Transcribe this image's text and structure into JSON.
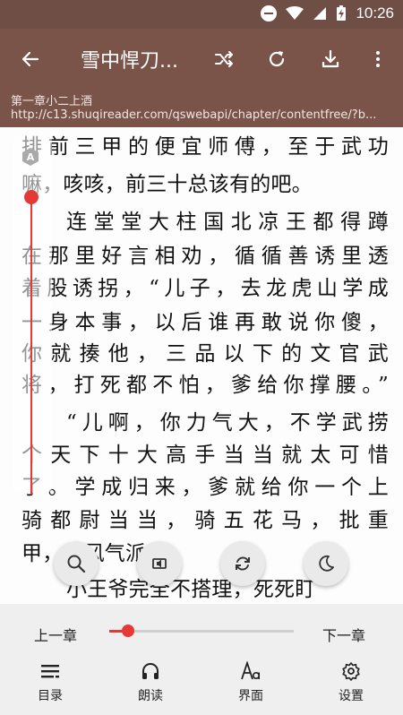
{
  "status": {
    "time": "10:26"
  },
  "toolbar": {
    "title": "雪中悍刀..."
  },
  "chapter": {
    "name": "第一章小二上酒",
    "url": "http://c13.shuqireader.com/qswebapi/chapter/contentfree/?b..."
  },
  "reader": {
    "lines": [
      "排前三甲的便宜师傅，至于武功",
      "嘛，咳咳，前三十总该有的吧。",
      "连堂堂大柱国北凉王都得蹲",
      "在那里好言相劝，循循善诱里透",
      "着股诱拐，“儿子，去龙虎山学成",
      "一身本事，以后谁再敢说你傻，",
      "你就揍他，三品以下的文官武",
      "将，打死都不怕，爹给你撑腰。”",
      "“儿啊，你力气大，不学武捞",
      "个天下十大高手当当就太可惜",
      "了。学成归来，爹就给你一个上",
      "骑都尉当当，骑五花马，批重",
      "甲，威风气派。”",
      "小王爷完全不搭理，死死盯"
    ],
    "slider_badge": "A",
    "slider_position": 0.02
  },
  "fabs": [
    "search-icon",
    "speaker-icon",
    "refresh-icon",
    "moon-icon"
  ],
  "chapter_nav": {
    "prev": "上一章",
    "next": "下一章",
    "progress": 0.1
  },
  "tabs": {
    "catalog": "目录",
    "read_aloud": "朗读",
    "interface": "界面",
    "settings": "设置"
  }
}
